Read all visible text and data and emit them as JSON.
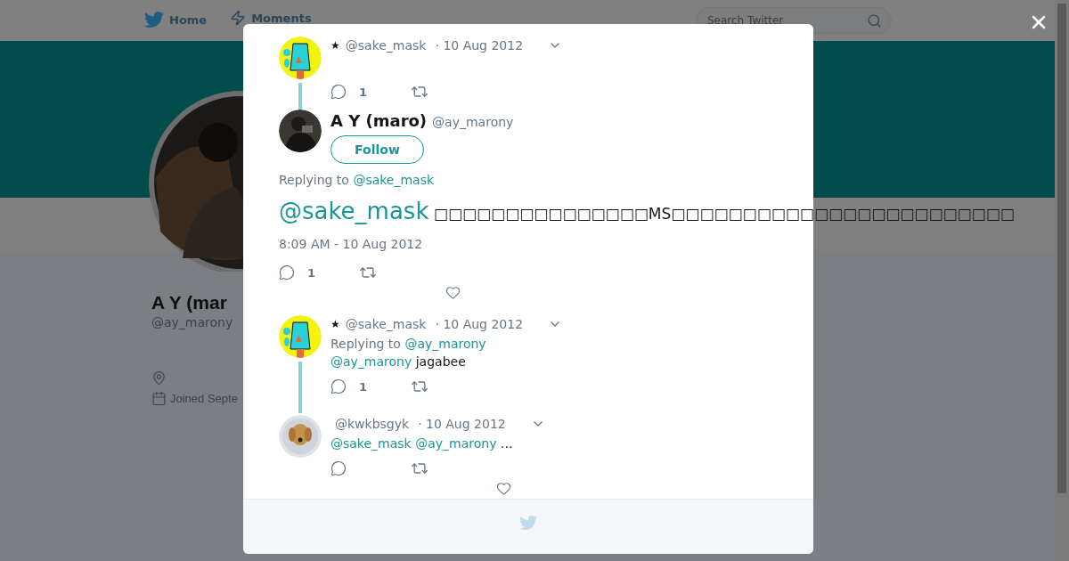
{
  "nav": {
    "items": [
      {
        "label": "Home"
      },
      {
        "label": "Moments"
      }
    ],
    "search": {
      "placeholder": "Search Twitter"
    }
  },
  "profile": {
    "name": "A Y (mar",
    "handle": "@ay_marony",
    "joined": "Joined Septe"
  },
  "thread": [
    {
      "kind": "context",
      "star": "★",
      "handle": "@sake_mask",
      "date": "· 10 Aug 2012",
      "reply_count": "1"
    },
    {
      "kind": "main",
      "name": "A Y (maro)",
      "handle": "@ay_marony",
      "follow": "Follow",
      "replying_label": "Replying to",
      "replying_to": "@sake_mask",
      "text": [
        {
          "kind": "mention",
          "text": "@sake_mask"
        },
        {
          "kind": "plain",
          "text": " □□□□□□□□□□□□□□□MS□□□□□□□□□□□□□□□□□□□□□□□□"
        }
      ],
      "time": "8:09 AM - 10 Aug 2012",
      "reply_count": "1"
    },
    {
      "kind": "reply",
      "star": "★",
      "handle": "@sake_mask",
      "date": "· 10 Aug 2012",
      "replying_label": "Replying to",
      "replying_to": "@ay_marony",
      "text": [
        {
          "kind": "mention",
          "text": "@ay_marony"
        },
        {
          "kind": "plain",
          "text": " jagabee"
        }
      ],
      "reply_count": "1"
    },
    {
      "kind": "last",
      "handle": "@kwkbsgyk",
      "date": "· 10 Aug 2012",
      "text": [
        {
          "kind": "mention",
          "text": "@sake_mask @ay_marony"
        },
        {
          "kind": "plain",
          "text": " …"
        }
      ]
    }
  ]
}
